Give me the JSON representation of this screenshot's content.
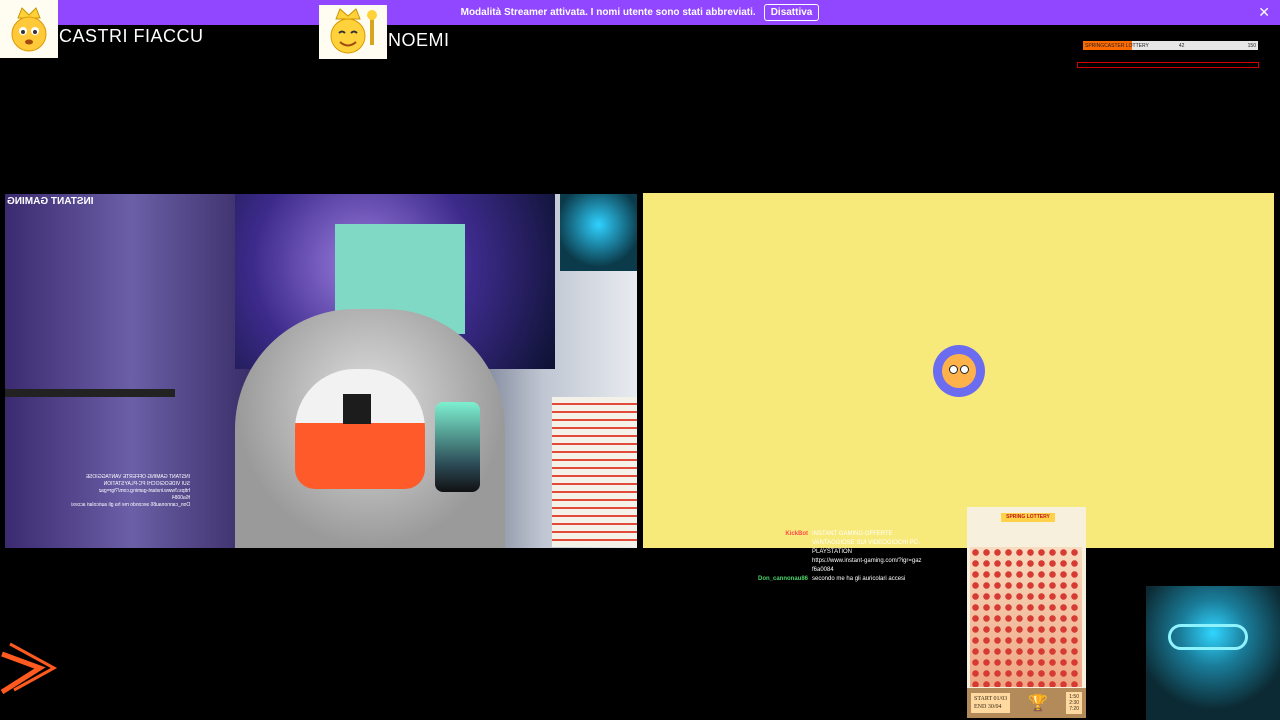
{
  "banner": {
    "message": "Modalità Streamer attivata. I nomi utente sono stati abbreviati.",
    "button_label": "Disattiva",
    "close_glyph": "✕",
    "color": "#9146ff"
  },
  "players": [
    {
      "name": "CASTRI FIACCU",
      "avatar_icon": "crowned-emoji-icon"
    },
    {
      "name": "NOEMI",
      "avatar_icon": "crowned-emoji-icon"
    }
  ],
  "lottery_bar": {
    "label": "SPRINGCASTER LOTTERY",
    "current": "42",
    "total": "150",
    "progress": 0.28,
    "fill_color": "#ff6a00"
  },
  "stream_left": {
    "logo_text": "INSTANT GAMING",
    "overlay_lines": [
      "INSTANT GAMING OFFERTE VANTAGGIOSE",
      "SUI VIDEOGIOCHI PC-PLAYSTATION",
      "https://www.instant-gaming.com/?igr=gaz",
      "f6a0084",
      "Don_cannonau86 secondo me ha gli auricolari accesi"
    ]
  },
  "chat": [
    {
      "user": "KickBot",
      "color": "#ff4a4a",
      "text": "INSTANT GAMING OFFERTE VANTAGGIOSE SUI VIDEOGIOCHI PC-PLAYSTATION"
    },
    {
      "user": "",
      "color": "#ffffff",
      "text": "https://www.instant-gaming.com/?igr=gaz"
    },
    {
      "user": "",
      "color": "#ffffff",
      "text": "f6a0084"
    },
    {
      "user": "Don_cannonau86",
      "color": "#4bd36a",
      "text": "secondo me ha gli auricolari accesi"
    }
  ],
  "lottery_card": {
    "title": "SPRING LOTTERY",
    "start": "START 01/03",
    "end": "END 30/04",
    "times": [
      "1:50",
      "2:30",
      "7:20"
    ],
    "trophy_icon": "trophy-icon"
  }
}
